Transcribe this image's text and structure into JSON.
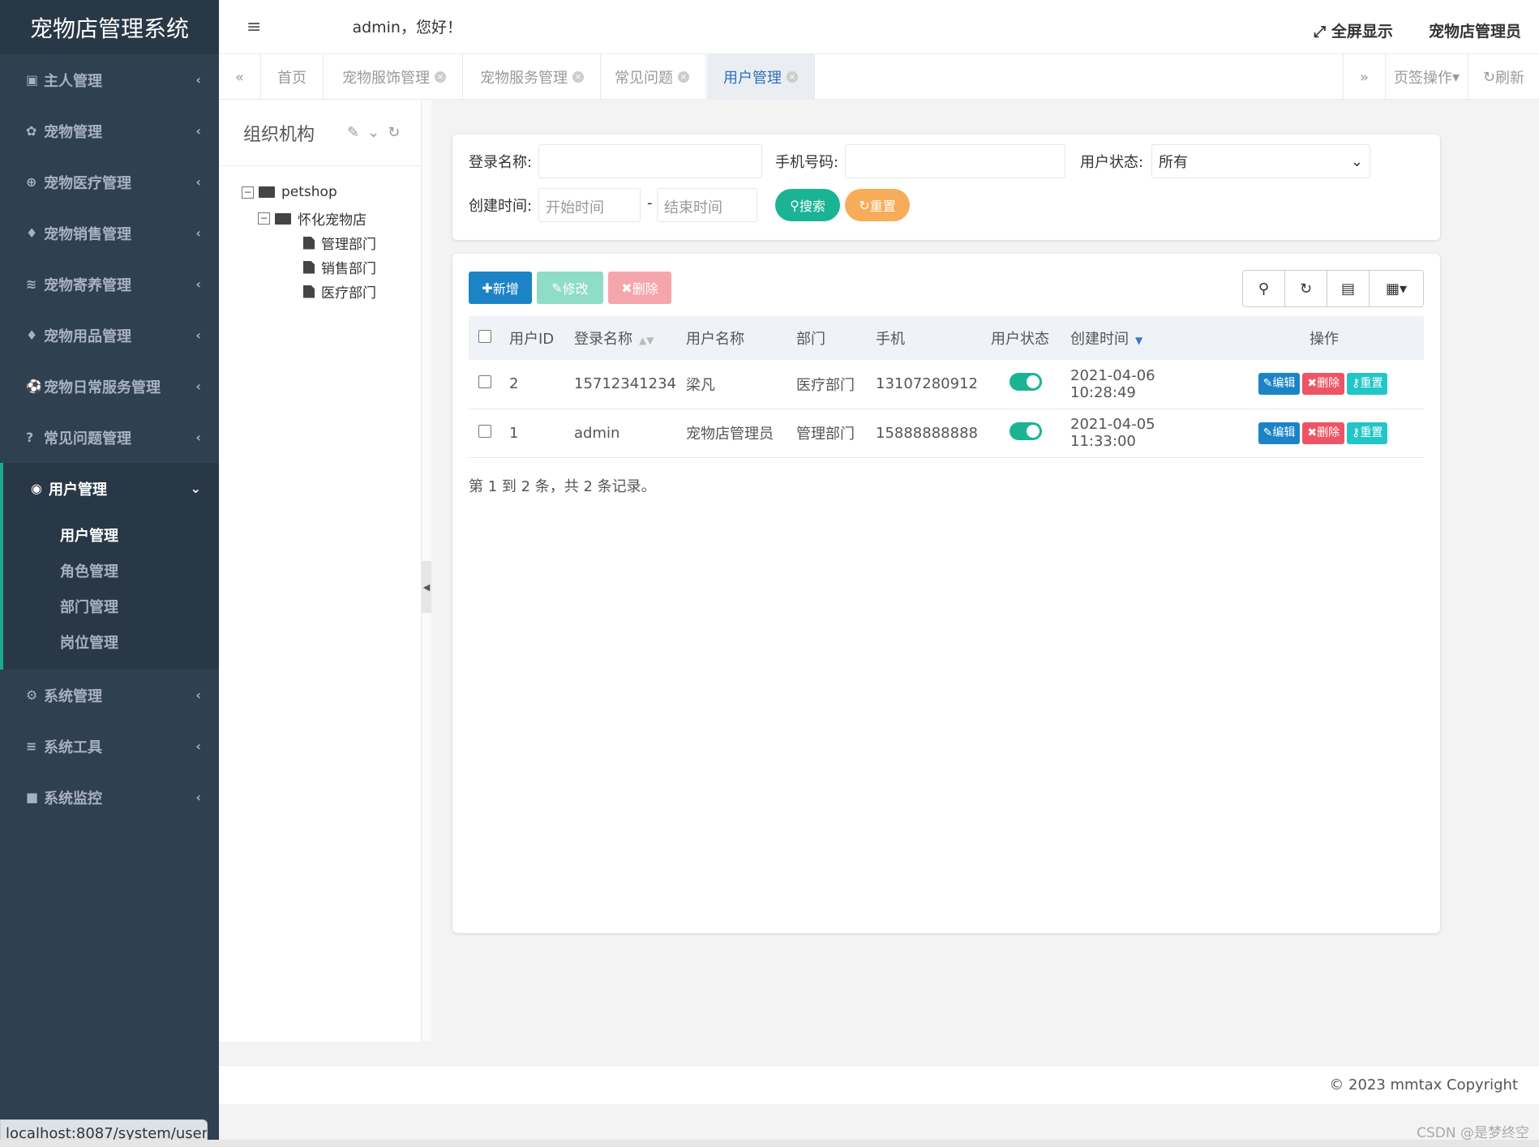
{
  "brand": "宠物店管理系统",
  "sidebar": {
    "items": [
      {
        "icon": "▣",
        "label": "主人管理"
      },
      {
        "icon": "✿",
        "label": "宠物管理"
      },
      {
        "icon": "⊕",
        "label": "宠物医疗管理"
      },
      {
        "icon": "♦",
        "label": "宠物销售管理"
      },
      {
        "icon": "≋",
        "label": "宠物寄养管理"
      },
      {
        "icon": "♦",
        "label": "宠物用品管理"
      },
      {
        "icon": "⚽",
        "label": "宠物日常服务管理"
      },
      {
        "icon": "?",
        "label": "常见问题管理"
      }
    ],
    "active": {
      "icon": "◉",
      "label": "用户管理",
      "sub": [
        "用户管理",
        "角色管理",
        "部门管理",
        "岗位管理"
      ]
    },
    "items_after": [
      {
        "icon": "⚙",
        "label": "系统管理"
      },
      {
        "icon": "≡",
        "label": "系统工具"
      },
      {
        "icon": "■",
        "label": "系统监控"
      }
    ]
  },
  "statusbar": "localhost:8087/system/user",
  "header": {
    "greeting": "admin，您好！",
    "fullscreen": "全屏显示",
    "username": "宠物店管理员"
  },
  "tabs": {
    "items": [
      "首页",
      "宠物服饰管理",
      "宠物服务管理",
      "常见问题",
      "用户管理"
    ],
    "operations": "页签操作",
    "refresh": "刷新"
  },
  "org": {
    "title": "组织机构",
    "tree": {
      "root": "petshop",
      "child": "怀化宠物店",
      "leaves": [
        "管理部门",
        "销售部门",
        "医疗部门"
      ]
    }
  },
  "search": {
    "login_label": "登录名称:",
    "phone_label": "手机号码:",
    "status_label": "用户状态:",
    "status_value": "所有",
    "created_label": "创建时间:",
    "start_placeholder": "开始时间",
    "end_placeholder": "结束时间",
    "dash": "-",
    "search_btn": "搜索",
    "reset_btn": "重置"
  },
  "toolbar": {
    "add": "新增",
    "edit": "修改",
    "delete": "删除"
  },
  "table": {
    "columns": [
      "用户ID",
      "登录名称",
      "用户名称",
      "部门",
      "手机",
      "用户状态",
      "创建时间",
      "操作"
    ],
    "rows": [
      {
        "id": "2",
        "login": "15712341234",
        "name": "梁凡",
        "dept": "医疗部门",
        "phone": "13107280912",
        "created": "2021-04-06 10:28:49"
      },
      {
        "id": "1",
        "login": "admin",
        "name": "宠物店管理员",
        "dept": "管理部门",
        "phone": "15888888888",
        "created": "2021-04-05 11:33:00"
      }
    ],
    "actions": {
      "edit": "编辑",
      "delete": "删除",
      "reset": "重置"
    },
    "page_info": "第 1 到 2 条，共 2 条记录。"
  },
  "footer": {
    "copyright": "© 2023 mmtax Copyright",
    "watermark": "CSDN @是梦终空"
  },
  "colors": {
    "sidebar_bg": "#2f4050",
    "primary": "#1c84c6",
    "success": "#1ab394",
    "danger": "#ed5565",
    "warning": "#f8ac59",
    "info": "#23c6c8"
  }
}
